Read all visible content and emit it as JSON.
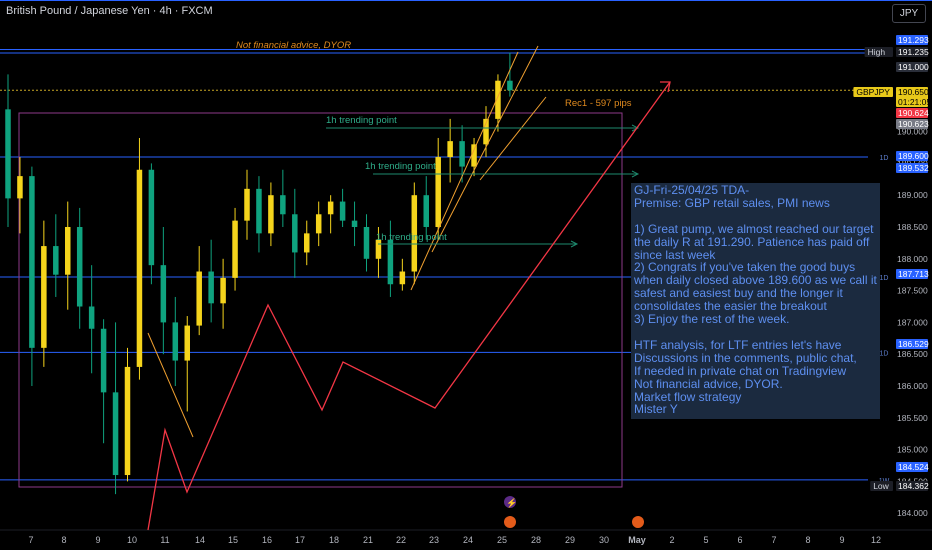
{
  "header": {
    "symbol_title": "British Pound / Japanese Yen · 4h · FXCM",
    "currency": "JPY"
  },
  "chart_data": {
    "type": "candlestick",
    "symbol": "GBPJPY",
    "timeframe": "4h",
    "y_axis": {
      "ticks": [
        191.0,
        190.5,
        190.0,
        189.5,
        189.0,
        188.5,
        188.0,
        187.5,
        187.0,
        186.5,
        186.0,
        185.5,
        185.0,
        184.5,
        184.0
      ],
      "tick_labels": [
        "191.000",
        "190.500",
        "190.000",
        "189.500",
        "189.000",
        "188.500",
        "188.000",
        "187.500",
        "187.000",
        "186.500",
        "186.000",
        "185.500",
        "185.000",
        "184.500",
        "184.000"
      ]
    },
    "x_axis": {
      "tick_labels": [
        "7",
        "8",
        "9",
        "10",
        "11",
        "14",
        "15",
        "16",
        "17",
        "18",
        "21",
        "22",
        "23",
        "24",
        "25",
        "28",
        "29",
        "30",
        "May",
        "2",
        "5",
        "6",
        "7",
        "8",
        "9",
        "12"
      ]
    },
    "price_labels": [
      {
        "label": "",
        "value": "191.293",
        "color": "#2962ff"
      },
      {
        "label": "High",
        "value": "191.235",
        "color": "#1c1e26"
      },
      {
        "label": "",
        "value": "191.000",
        "color": "#2a2e39"
      },
      {
        "label": "GBPJPY",
        "value": "190.650",
        "sub": "01:21:05",
        "color": "#e8c91a"
      },
      {
        "label": "",
        "value": "190.624",
        "color": "#f23645"
      },
      {
        "label": "",
        "value": "190.623",
        "color": "#787b86"
      },
      {
        "label": "",
        "value": "189.600",
        "color": "#2962ff"
      },
      {
        "label": "",
        "value": "189.532",
        "color": "#2962ff"
      },
      {
        "label": "",
        "value": "187.713",
        "color": "#2962ff"
      },
      {
        "label": "",
        "value": "186.529",
        "color": "#2962ff"
      },
      {
        "label": "",
        "value": "184.524",
        "color": "#2962ff"
      },
      {
        "label": "Low",
        "value": "184.362",
        "color": "#1c1e26"
      }
    ],
    "horizontal_levels": [
      191.29,
      191.235,
      189.6,
      187.713,
      186.529,
      184.524
    ],
    "level_tags": [
      "1D",
      "1D",
      "1D",
      "1D",
      "1W"
    ],
    "annotations": {
      "disclaimer": "Not financial advice, DYOR",
      "rec1": "Rec1 - 597 pips",
      "trend1": "1h trending point",
      "trend2": "1h trending point",
      "trend3": "1h trending point"
    },
    "candles": [
      {
        "o": 190.35,
        "h": 190.9,
        "l": 188.5,
        "c": 188.95
      },
      {
        "o": 188.95,
        "h": 189.6,
        "l": 188.4,
        "c": 189.3
      },
      {
        "o": 189.3,
        "h": 189.45,
        "l": 186.0,
        "c": 186.6
      },
      {
        "o": 186.6,
        "h": 188.6,
        "l": 186.3,
        "c": 188.2
      },
      {
        "o": 188.2,
        "h": 188.7,
        "l": 187.4,
        "c": 187.75
      },
      {
        "o": 187.75,
        "h": 188.9,
        "l": 187.2,
        "c": 188.5
      },
      {
        "o": 188.5,
        "h": 188.8,
        "l": 186.9,
        "c": 187.25
      },
      {
        "o": 187.25,
        "h": 187.9,
        "l": 186.2,
        "c": 186.9
      },
      {
        "o": 186.9,
        "h": 187.05,
        "l": 185.1,
        "c": 185.9
      },
      {
        "o": 185.9,
        "h": 187.0,
        "l": 184.3,
        "c": 184.6
      },
      {
        "o": 184.6,
        "h": 186.6,
        "l": 184.5,
        "c": 186.3
      },
      {
        "o": 186.3,
        "h": 189.9,
        "l": 186.1,
        "c": 189.4
      },
      {
        "o": 189.4,
        "h": 189.5,
        "l": 187.6,
        "c": 187.9
      },
      {
        "o": 187.9,
        "h": 188.5,
        "l": 186.5,
        "c": 187.0
      },
      {
        "o": 187.0,
        "h": 187.4,
        "l": 186.0,
        "c": 186.4
      },
      {
        "o": 186.4,
        "h": 187.1,
        "l": 185.6,
        "c": 186.95
      },
      {
        "o": 186.95,
        "h": 188.2,
        "l": 186.8,
        "c": 187.8
      },
      {
        "o": 187.8,
        "h": 188.3,
        "l": 187.0,
        "c": 187.3
      },
      {
        "o": 187.3,
        "h": 188.0,
        "l": 186.9,
        "c": 187.7
      },
      {
        "o": 187.7,
        "h": 188.8,
        "l": 187.5,
        "c": 188.6
      },
      {
        "o": 188.6,
        "h": 189.4,
        "l": 188.3,
        "c": 189.1
      },
      {
        "o": 189.1,
        "h": 189.3,
        "l": 188.1,
        "c": 188.4
      },
      {
        "o": 188.4,
        "h": 189.2,
        "l": 188.2,
        "c": 189.0
      },
      {
        "o": 189.0,
        "h": 189.4,
        "l": 188.5,
        "c": 188.7
      },
      {
        "o": 188.7,
        "h": 189.1,
        "l": 187.7,
        "c": 188.1
      },
      {
        "o": 188.1,
        "h": 188.6,
        "l": 187.9,
        "c": 188.4
      },
      {
        "o": 188.4,
        "h": 188.9,
        "l": 188.2,
        "c": 188.7
      },
      {
        "o": 188.7,
        "h": 189.0,
        "l": 188.4,
        "c": 188.9
      },
      {
        "o": 188.9,
        "h": 189.1,
        "l": 188.5,
        "c": 188.6
      },
      {
        "o": 188.6,
        "h": 188.9,
        "l": 188.2,
        "c": 188.5
      },
      {
        "o": 188.5,
        "h": 188.7,
        "l": 187.8,
        "c": 188.0
      },
      {
        "o": 188.0,
        "h": 188.5,
        "l": 187.7,
        "c": 188.3
      },
      {
        "o": 188.3,
        "h": 188.6,
        "l": 187.4,
        "c": 187.6
      },
      {
        "o": 187.6,
        "h": 188.0,
        "l": 187.5,
        "c": 187.8
      },
      {
        "o": 187.8,
        "h": 189.2,
        "l": 187.6,
        "c": 189.0
      },
      {
        "o": 189.0,
        "h": 189.3,
        "l": 188.3,
        "c": 188.5
      },
      {
        "o": 188.5,
        "h": 189.9,
        "l": 188.3,
        "c": 189.6
      },
      {
        "o": 189.6,
        "h": 190.2,
        "l": 189.2,
        "c": 189.85
      },
      {
        "o": 189.85,
        "h": 190.1,
        "l": 189.2,
        "c": 189.45
      },
      {
        "o": 189.45,
        "h": 189.9,
        "l": 189.3,
        "c": 189.8
      },
      {
        "o": 189.8,
        "h": 190.4,
        "l": 189.6,
        "c": 190.2
      },
      {
        "o": 190.2,
        "h": 190.9,
        "l": 190.0,
        "c": 190.8
      },
      {
        "o": 190.8,
        "h": 191.24,
        "l": 190.55,
        "c": 190.65
      }
    ]
  },
  "analysis": {
    "text": "GJ-Fri-25/04/25 TDA-\nPremise: GBP retail sales, PMI news\n\n1) Great pump, we almost reached our target the daily R at 191.290. Patience has paid off since last week\n2) Congrats if you've taken the good buys when daily closed above 189.600 as we call it safest and easiest buy and the longer it consolidates the easier the breakout\n3) Enjoy the rest of the week.\n\nHTF analysis, for LTF entries let's have Discussions in the comments, public chat,\nIf needed in private chat on Tradingview\nNot financial advice, DYOR.\nMarket flow strategy\nMister Y"
  },
  "colors": {
    "background": "#000000",
    "up": "#f5d41c",
    "down": "#0fa37f",
    "level": "#2962ff",
    "projection": "#f23645",
    "channel": "#f0a030",
    "box": "#8e3a8a",
    "trend": "#1e8a6e",
    "text": "#d1d4dc"
  }
}
